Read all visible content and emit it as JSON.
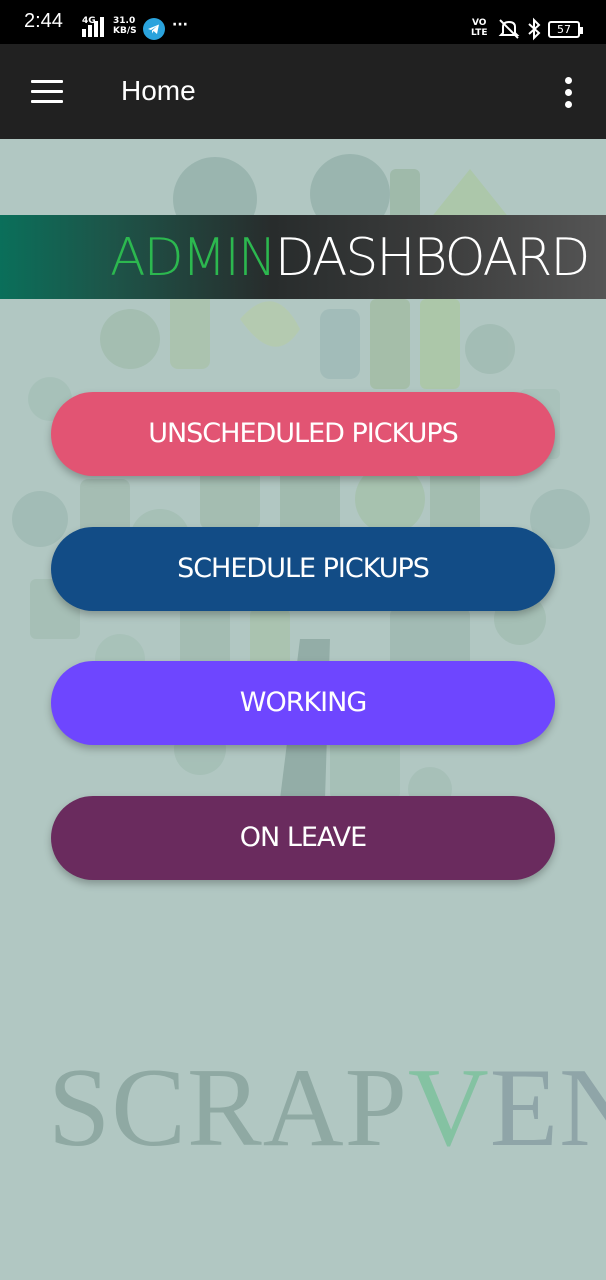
{
  "status_bar": {
    "time": "2:44",
    "network_type": "4G",
    "speed": "31.0",
    "speed_unit": "KB/S",
    "more": "···",
    "volte_line1": "VO",
    "volte_line2": "LTE",
    "battery": "57",
    "icons": [
      "signal-icon",
      "telegram-icon",
      "volte-icon",
      "mute-icon",
      "bluetooth-icon",
      "battery-icon"
    ]
  },
  "app_bar": {
    "title": "Home",
    "menu_icon": "hamburger-menu-icon",
    "more_icon": "more-vert-icon",
    "background": "#212121"
  },
  "banner": {
    "part1": "ADMIN",
    "part2": "DASHBOARD",
    "part1_color": "#2cb84f",
    "part2_color": "#ffffff"
  },
  "buttons": [
    {
      "label": "UNSCHEDULED PICKUPS",
      "color": "#e25473"
    },
    {
      "label": "SCHEDULE PICKUPS",
      "color": "#124c86"
    },
    {
      "label": "WORKING",
      "color": "#6e46ff"
    },
    {
      "label": "ON LEAVE",
      "color": "#6a2b5e"
    }
  ],
  "watermark": {
    "part1": "SCRAP",
    "part2": "V",
    "part3": "END",
    "part1_color": "#8fa9a3",
    "part2_color": "#84c2a2",
    "part3_color": "#8fa5a8"
  },
  "background_color": "#b1c7c2"
}
